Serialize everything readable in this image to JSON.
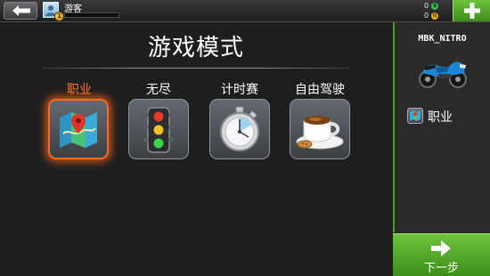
{
  "topbar": {
    "player_name": "游客",
    "level": "1",
    "currencies": [
      {
        "value": "0",
        "icon": "cash-icon",
        "color": "#3fb84a"
      },
      {
        "value": "0",
        "icon": "gold-coin-icon",
        "color": "#e3b21c"
      }
    ]
  },
  "main": {
    "title": "游戏模式",
    "modes": [
      {
        "label": "职业",
        "icon": "folded-map-icon",
        "selected": true
      },
      {
        "label": "无尽",
        "icon": "traffic-light-icon",
        "selected": false
      },
      {
        "label": "计时赛",
        "icon": "stopwatch-icon",
        "selected": false
      },
      {
        "label": "自由驾驶",
        "icon": "coffee-cup-icon",
        "selected": false
      }
    ]
  },
  "side_panel": {
    "vehicle_name": "MBK_NITRO",
    "selected_mode": "职业"
  },
  "next_button": {
    "label": "下一步"
  },
  "colors": {
    "accent_green": "#5bb52f",
    "selected_orange": "#ff6a1a"
  }
}
